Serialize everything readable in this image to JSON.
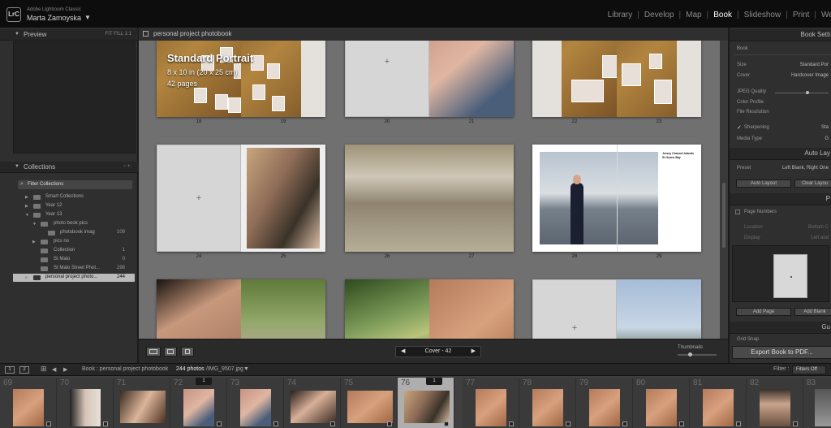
{
  "app": {
    "logo": "LrC",
    "subtitle": "Adobe Lightroom Classic",
    "user": "Marta Zamoyska",
    "user_caret": "▼"
  },
  "modules": [
    "Library",
    "Develop",
    "Map",
    "Book",
    "Slideshow",
    "Print",
    "Web"
  ],
  "active_module": "Book",
  "left_panel": {
    "preview_title": "Preview",
    "collections_title": "Collections",
    "collections_actions": [
      "−",
      "+."
    ],
    "filter_placeholder": "Filter Collections",
    "items": [
      {
        "label": "Smart Collections",
        "count": ""
      },
      {
        "label": "Year 12",
        "count": ""
      },
      {
        "label": "Year 13",
        "count": ""
      },
      {
        "label": "photo book pics",
        "count": ""
      },
      {
        "label": "photobook imag",
        "count": "109"
      },
      {
        "label": "pics no",
        "count": ""
      },
      {
        "label": "Collection",
        "count": "1"
      },
      {
        "label": "St Malo",
        "count": "0"
      },
      {
        "label": "St Malo Street Phot...",
        "count": "298"
      },
      {
        "label": "personal project photo...",
        "count": "244"
      }
    ]
  },
  "center": {
    "header_title": "personal project photobook",
    "cover_title": "Standard Portrait",
    "cover_size": "8 x 10 in (20 x 25 cm)",
    "cover_pages": "42 pages",
    "page_numbers": [
      "18",
      "19",
      "20",
      "21",
      "22",
      "23",
      "24",
      "25",
      "26",
      "27",
      "28",
      "29"
    ],
    "beach_caption": [
      "Jersey Channel Islands",
      "St Ouens Bay"
    ],
    "page_nav": "Cover - 42",
    "page_nav_prev": "◀",
    "page_nav_next": "▶",
    "thumbnails_label": "Thumbnails",
    "thumbnails_level": 0.3
  },
  "right_panel": {
    "book_settings_title": "Book Setti",
    "book_label": "Book",
    "rows": [
      {
        "k": "Size",
        "v": "Standard Por"
      },
      {
        "k": "Cover",
        "v": "Hardcover Image"
      },
      {
        "k": "JPEG Quality",
        "v": ""
      },
      {
        "k": "Color Profile",
        "v": ""
      },
      {
        "k": "File Resolution",
        "v": ""
      },
      {
        "k": "Sharpening",
        "v": "Sta"
      },
      {
        "k": "Media Type",
        "v": "G"
      }
    ],
    "auto_layout_title": "Auto Lay",
    "preset_label": "Preset",
    "preset_value": "Left Blank, Right One",
    "auto_layout_btn": "Auto Layout",
    "clear_layout_btn": "Clear Layou",
    "page_section_title": "P",
    "page_numbers_label": "Page Numbers",
    "location_label": "Location",
    "location_value": "Bottom C",
    "display_label": "Display",
    "display_value": "Left and",
    "add_page_btn": "Add Page",
    "add_blank_btn": "Add Blank",
    "guides_title": "Gu",
    "grid_snap_label": "Grid Snap",
    "export_btn": "Export Book to PDF..."
  },
  "filmbar": {
    "view1": "1",
    "view2": "2",
    "source": "Book : personal project photobook",
    "count": "244 photos",
    "file": "/IMG_9507.jpg",
    "file_caret": "▼",
    "filter_label": "Filter :",
    "filter_value": "Filters Off"
  },
  "filmstrip": {
    "numbers": [
      "69",
      "70",
      "71",
      "72",
      "73",
      "74",
      "75",
      "76",
      "77",
      "78",
      "79",
      "80",
      "81",
      "82",
      "83"
    ],
    "badges": [
      "1",
      "1"
    ]
  },
  "colors": {
    "active_module": "#ffffff",
    "panel": "#2f2f2f",
    "canvas": "#707070",
    "selected_cell": "#aeaeae"
  }
}
